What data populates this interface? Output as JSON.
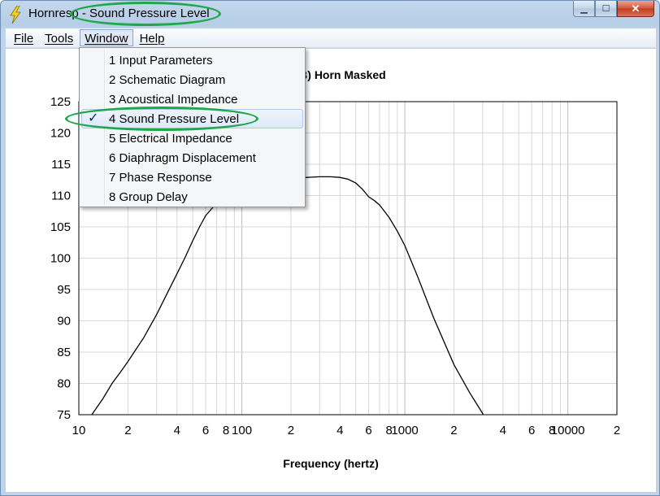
{
  "window": {
    "title_prefix": "Hornresp - ",
    "title_highlight": "Sound Pressure Level",
    "min_glyph": "▁",
    "max_glyph": "☐",
    "close_glyph": "✕"
  },
  "menubar": {
    "items": [
      "File",
      "Tools",
      "Window",
      "Help"
    ],
    "active": "Window"
  },
  "dropdown": {
    "check_glyph": "✓",
    "items": [
      {
        "label": "1  Input Parameters",
        "checked": false
      },
      {
        "label": "2  Schematic Diagram",
        "checked": false
      },
      {
        "label": "3  Acoustical Impedance",
        "checked": false
      },
      {
        "label": "4  Sound Pressure Level",
        "checked": true
      },
      {
        "label": "5  Electrical Impedance",
        "checked": false
      },
      {
        "label": "6  Diaphragm Displacement",
        "checked": false
      },
      {
        "label": "7  Phase Response",
        "checked": false
      },
      {
        "label": "8  Group Delay",
        "checked": false
      }
    ]
  },
  "colors": {
    "annotation": "#1fa84a",
    "grid": "#d8d8d8",
    "grid_major": "#bdbdbd",
    "curve": "#000000"
  },
  "chart_data": {
    "type": "line",
    "title": "Sound Pressure Level (dB)   Horn   Masked",
    "xlabel": "Frequency (hertz)",
    "x_scale": "log",
    "xlim": [
      10,
      20000
    ],
    "ylim": [
      75,
      125
    ],
    "yticks": [
      75,
      80,
      85,
      90,
      95,
      100,
      105,
      110,
      115,
      120,
      125
    ],
    "xtick_labels": [
      {
        "value": 10,
        "label": "10"
      },
      {
        "value": 20,
        "label": "2"
      },
      {
        "value": 40,
        "label": "4"
      },
      {
        "value": 60,
        "label": "6"
      },
      {
        "value": 80,
        "label": "8"
      },
      {
        "value": 100,
        "label": "100"
      },
      {
        "value": 200,
        "label": "2"
      },
      {
        "value": 400,
        "label": "4"
      },
      {
        "value": 600,
        "label": "6"
      },
      {
        "value": 800,
        "label": "8"
      },
      {
        "value": 1000,
        "label": "1000"
      },
      {
        "value": 2000,
        "label": "2"
      },
      {
        "value": 4000,
        "label": "4"
      },
      {
        "value": 6000,
        "label": "6"
      },
      {
        "value": 8000,
        "label": "8"
      },
      {
        "value": 10000,
        "label": "10000"
      },
      {
        "value": 20000,
        "label": "2"
      }
    ],
    "grid": true,
    "series": [
      {
        "x": [
          12,
          14,
          16,
          18,
          20,
          25,
          30,
          35,
          40,
          45,
          50,
          55,
          60,
          70,
          80,
          90,
          100,
          120,
          150,
          200,
          250,
          300,
          350,
          400,
          450,
          500,
          550,
          600,
          650,
          700,
          800,
          900,
          1000,
          1200,
          1500,
          2000,
          2500,
          3000,
          3300
        ],
        "y": [
          75,
          77.5,
          80,
          81.8,
          83.5,
          87.3,
          91,
          94.5,
          97.5,
          100.2,
          102.8,
          105,
          106.8,
          108.8,
          110,
          110.7,
          111.2,
          111.7,
          112.2,
          112.6,
          112.9,
          113,
          113,
          112.9,
          112.6,
          112,
          111,
          109.8,
          109.2,
          108.5,
          106.5,
          104.3,
          102,
          97,
          90.5,
          83,
          78.5,
          75.2,
          73
        ]
      }
    ]
  }
}
